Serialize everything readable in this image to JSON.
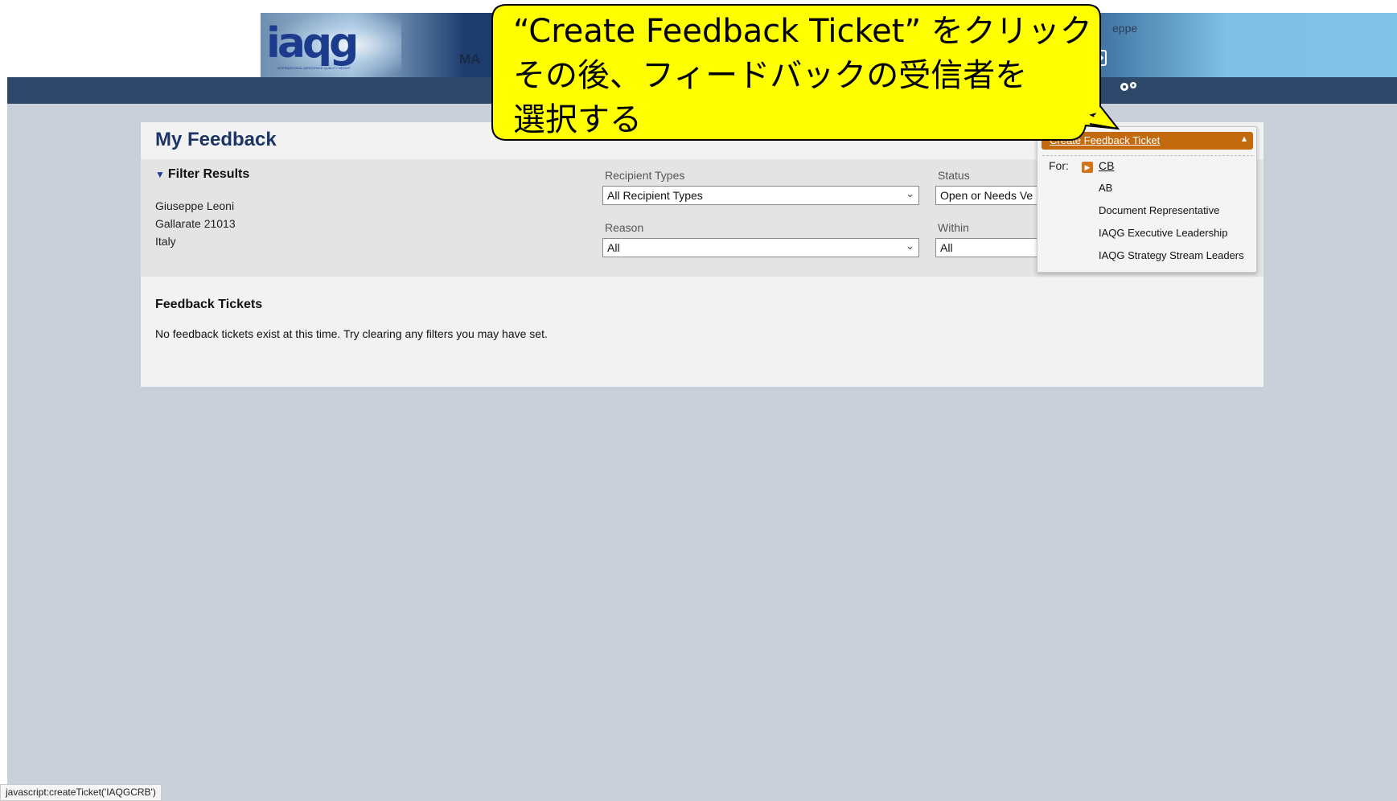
{
  "header": {
    "logo_text": "iaqg",
    "logo_sub": "INTERNATIONAL AEROSPACE QUALITY GROUP",
    "nav_label": "MA",
    "user_name": "eppe",
    "icons": [
      "logout-icon",
      "gear-icon"
    ]
  },
  "page": {
    "title": "My Feedback"
  },
  "filter": {
    "heading": "Filter Results",
    "address": [
      "Giuseppe Leoni",
      "Gallarate 21013",
      "Italy"
    ],
    "recipient_types": {
      "label": "Recipient Types",
      "value": "All Recipient Types"
    },
    "status": {
      "label": "Status",
      "value": "Open or Needs Ve"
    },
    "reason": {
      "label": "Reason",
      "value": "All"
    },
    "within": {
      "label": "Within",
      "value": "All"
    }
  },
  "tickets": {
    "heading": "Feedback Tickets",
    "empty_message": "No feedback tickets exist at this time. Try clearing any filters you may have set."
  },
  "dropdown": {
    "button_label": "Create Feedback Ticket",
    "for_label": "For:",
    "items": [
      "CB",
      "AB",
      "Document Representative",
      "IAQG Executive Leadership",
      "IAQG Strategy Stream Leaders"
    ]
  },
  "callout": {
    "text": "“Create Feedback Ticket” をクリック\nその後、フィードバックの受信者を\n選択する",
    "fill": "#ffff00"
  },
  "statusbar": {
    "text": "javascript:createTicket('IAQGCRB')"
  },
  "colors": {
    "navbar": "#2d4868",
    "accent_orange": "#c46a0e",
    "title_blue": "#1d3566"
  }
}
